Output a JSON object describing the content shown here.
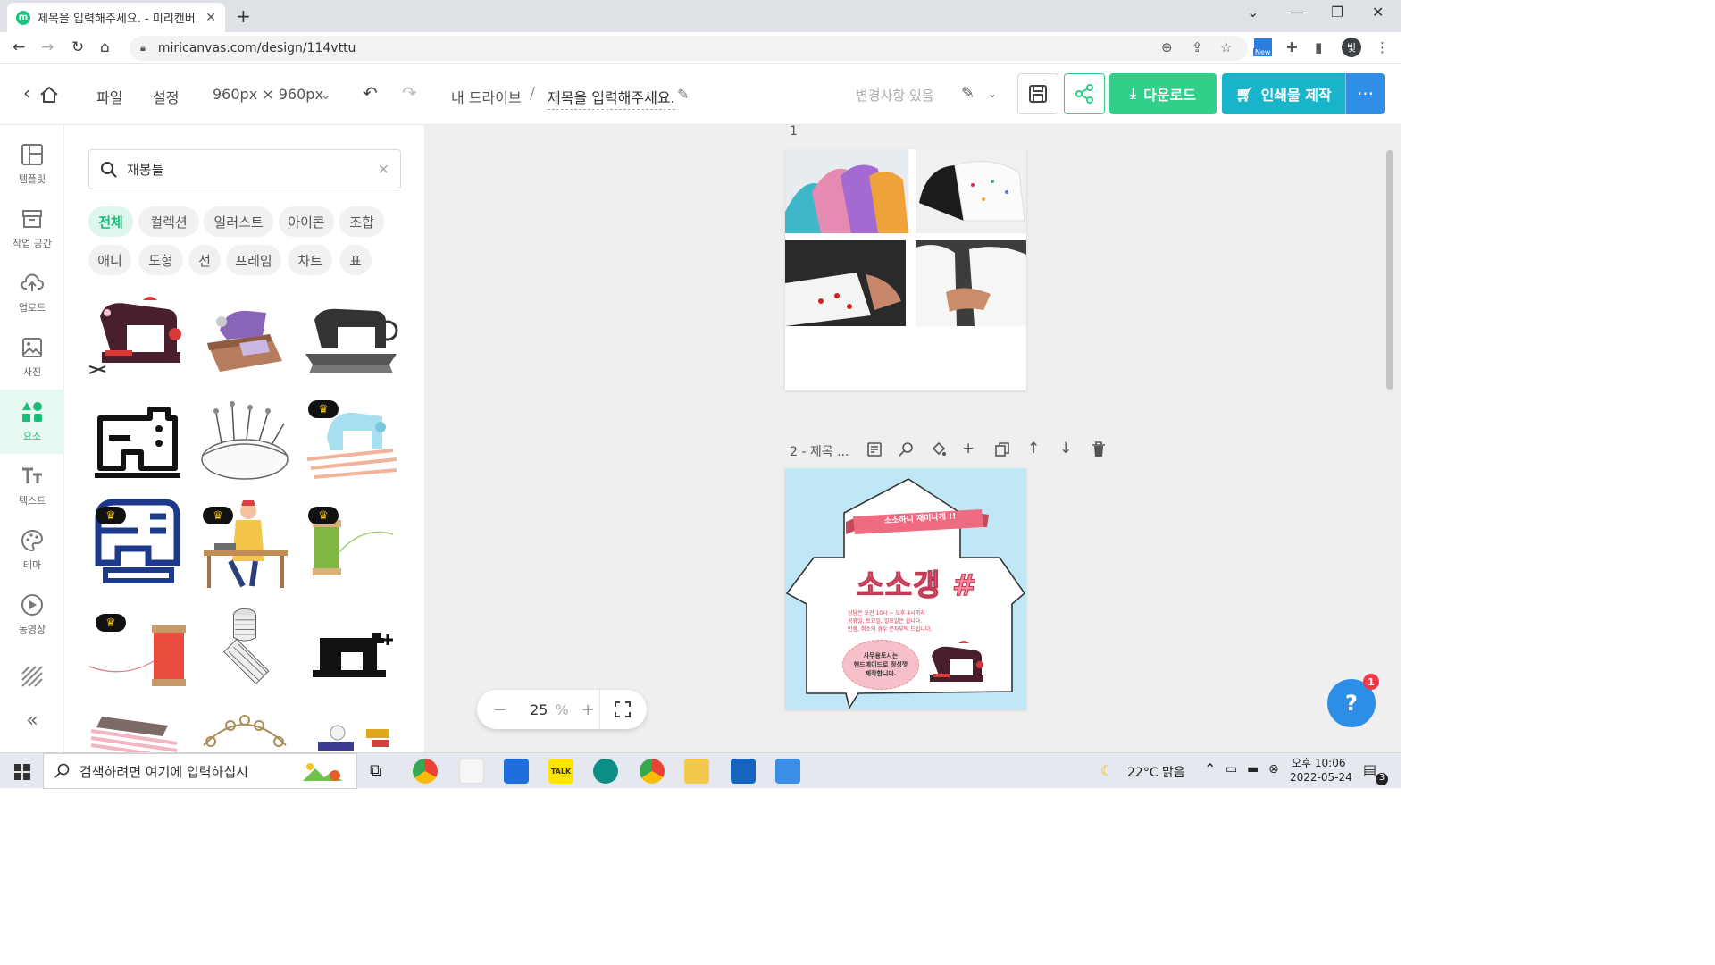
{
  "browser": {
    "tab_title": "제목을 입력해주세요. - 미리캔버",
    "favicon_letter": "m",
    "url": "miricanvas.com/design/114vttu",
    "ext_new_label": "New",
    "profile_initial": "빛"
  },
  "header": {
    "menu_file": "파일",
    "menu_settings": "설정",
    "size_label": "960px × 960px",
    "breadcrumb_drive": "내 드라이브",
    "breadcrumb_sep": "/",
    "doc_title": "제목을 입력해주세요.",
    "save_status": "변경사항 있음",
    "download_label": "다운로드",
    "print_label": "인쇄물 제작",
    "more_label": "···"
  },
  "leftnav": {
    "items": [
      {
        "label": "템플릿",
        "icon": "template-icon"
      },
      {
        "label": "작업 공간",
        "icon": "workspace-icon"
      },
      {
        "label": "업로드",
        "icon": "upload-icon"
      },
      {
        "label": "사진",
        "icon": "photo-icon"
      },
      {
        "label": "요소",
        "icon": "elements-icon",
        "active": true
      },
      {
        "label": "텍스트",
        "icon": "text-icon"
      },
      {
        "label": "테마",
        "icon": "theme-icon"
      },
      {
        "label": "동영상",
        "icon": "video-icon"
      }
    ]
  },
  "panel": {
    "search_value": "재봉틀",
    "filters_row1": [
      "전체",
      "컬렉션",
      "일러스트",
      "아이콘",
      "조합"
    ],
    "filters_row2": [
      "애니",
      "도형",
      "선",
      "프레임",
      "차트",
      "표"
    ]
  },
  "canvas": {
    "page1_label": "1",
    "page2_label": "2 - 제목 ...",
    "poster_banner": "소소하니 재미나게 !!",
    "poster_title": "소소갱 #",
    "poster_info_lines": [
      "상담은 오전 10시 ~ 오후 4시까지",
      "공휴일, 토요일, 일요일은 쉽니다.",
      "반품, 취소의 경우 문자부탁 드립니다."
    ],
    "poster_bubble_lines": [
      "사무용토시는",
      "핸드메이드로 정성껏",
      "제작합니다."
    ],
    "zoom_value": "25",
    "zoom_unit": "%",
    "help_badge": "1"
  },
  "taskbar": {
    "search_placeholder": "검색하려면 여기에 입력하십시",
    "weather": "22°C  맑음",
    "time": "오후 10:06",
    "date": "2022-05-24",
    "notif_count": "3"
  },
  "colors": {
    "brand_green": "#30cf8a",
    "teal": "#18b4c9",
    "blue": "#2f8ee8",
    "poster_bg": "#bfe7f6",
    "poster_pink": "#ef6b82"
  }
}
